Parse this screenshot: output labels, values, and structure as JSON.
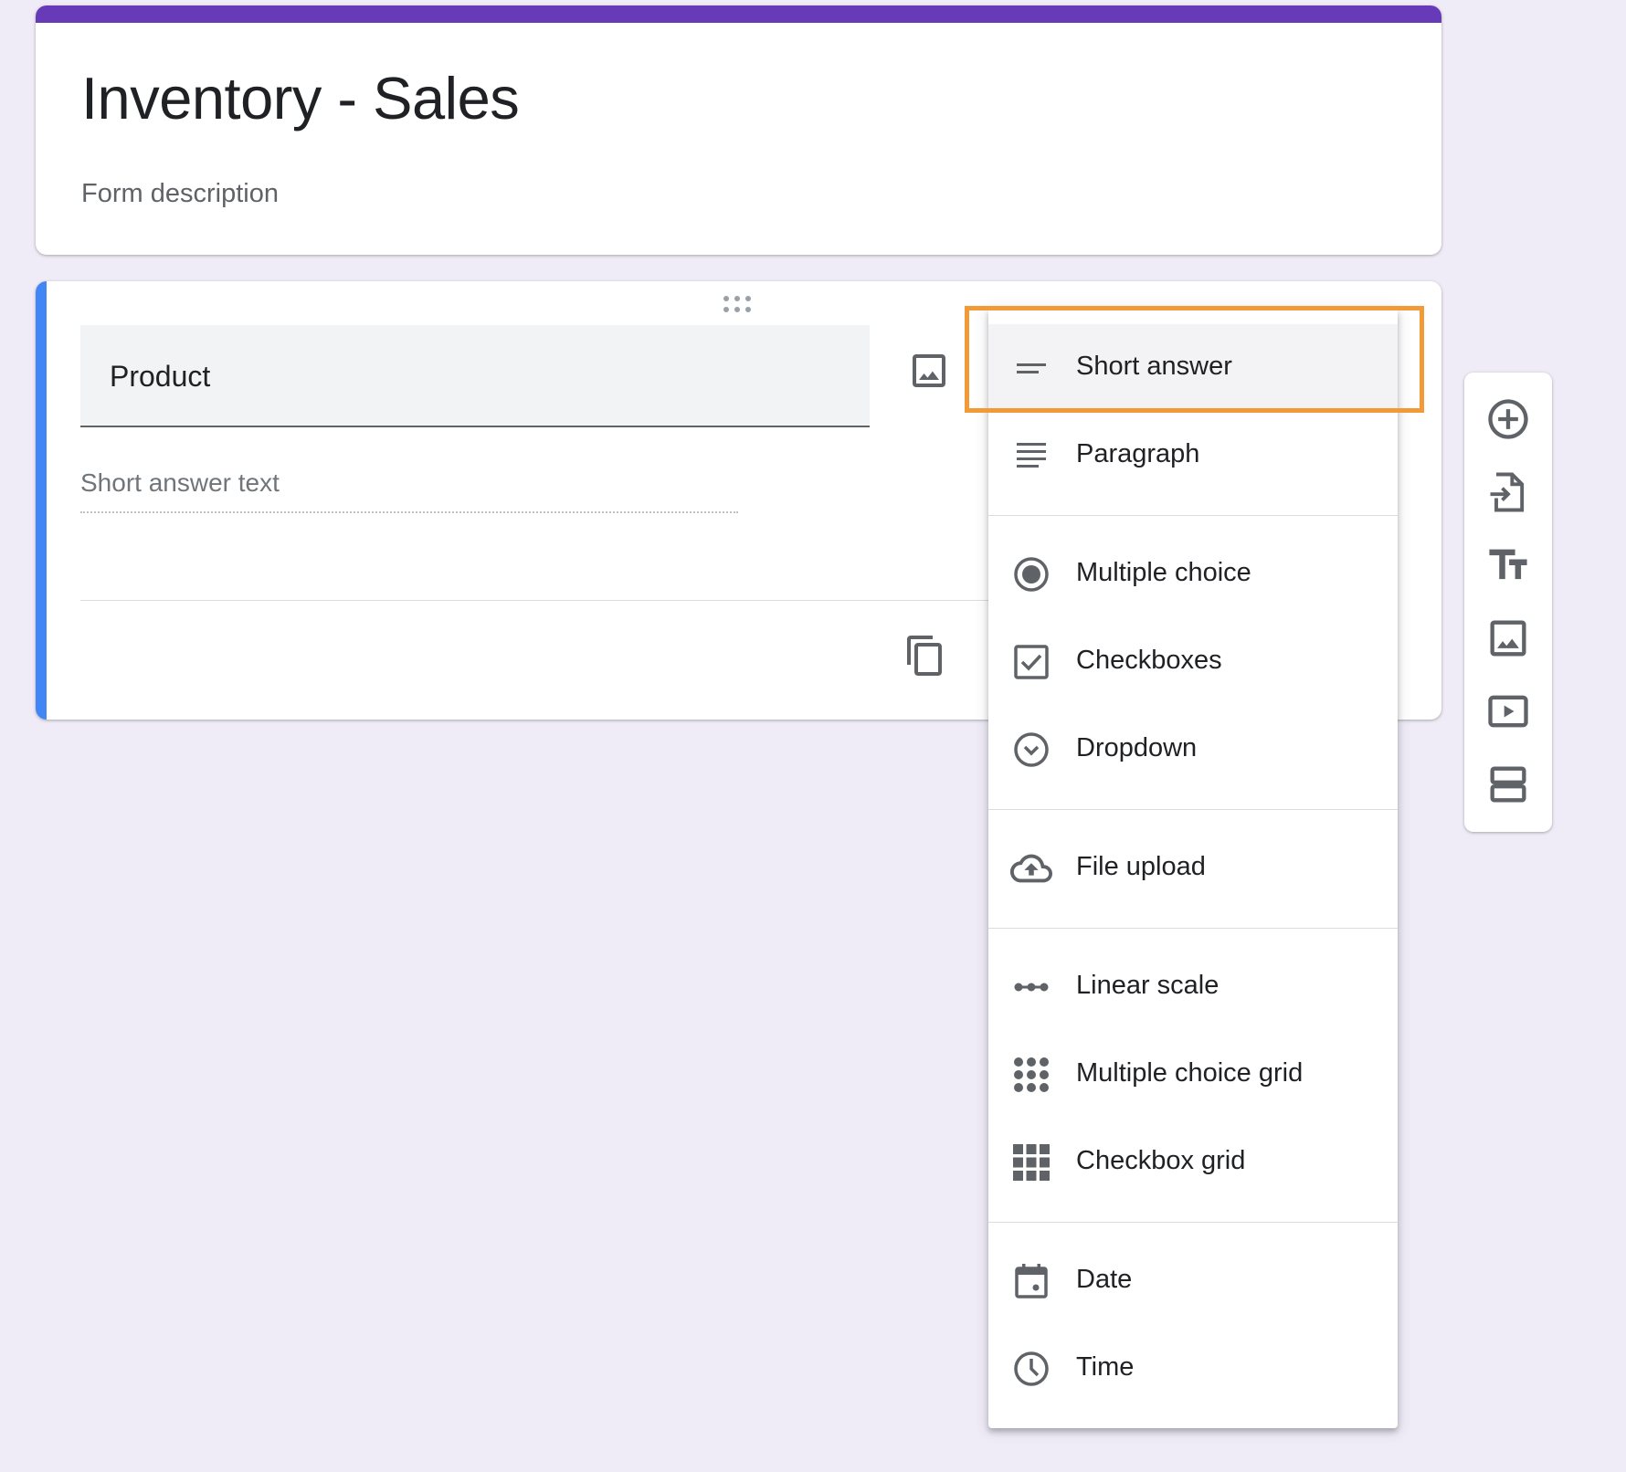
{
  "form": {
    "title": "Inventory - Sales",
    "description_placeholder": "Form description",
    "theme_color": "#673ab7"
  },
  "question": {
    "title": "Product",
    "answer_placeholder": "Short answer text",
    "accent_color": "#4285f4"
  },
  "type_menu": {
    "selected": "Short answer",
    "highlight_color": "#f29a38",
    "items": [
      {
        "label": "Short answer",
        "icon": "short-answer-icon"
      },
      {
        "label": "Paragraph",
        "icon": "paragraph-icon"
      },
      {
        "label": "Multiple choice",
        "icon": "radio-button-icon"
      },
      {
        "label": "Checkboxes",
        "icon": "checkbox-icon"
      },
      {
        "label": "Dropdown",
        "icon": "dropdown-circle-icon"
      },
      {
        "label": "File upload",
        "icon": "cloud-upload-icon"
      },
      {
        "label": "Linear scale",
        "icon": "linear-scale-icon"
      },
      {
        "label": "Multiple choice grid",
        "icon": "dot-grid-icon"
      },
      {
        "label": "Checkbox grid",
        "icon": "square-grid-icon"
      },
      {
        "label": "Date",
        "icon": "calendar-icon"
      },
      {
        "label": "Time",
        "icon": "clock-icon"
      }
    ]
  },
  "toolbar": {
    "items": [
      {
        "name": "add-question",
        "icon": "add-circle-icon"
      },
      {
        "name": "import-questions",
        "icon": "import-file-icon"
      },
      {
        "name": "add-title-description",
        "icon": "text-size-icon"
      },
      {
        "name": "add-image",
        "icon": "image-icon"
      },
      {
        "name": "add-video",
        "icon": "video-icon"
      },
      {
        "name": "add-section",
        "icon": "section-icon"
      }
    ]
  }
}
